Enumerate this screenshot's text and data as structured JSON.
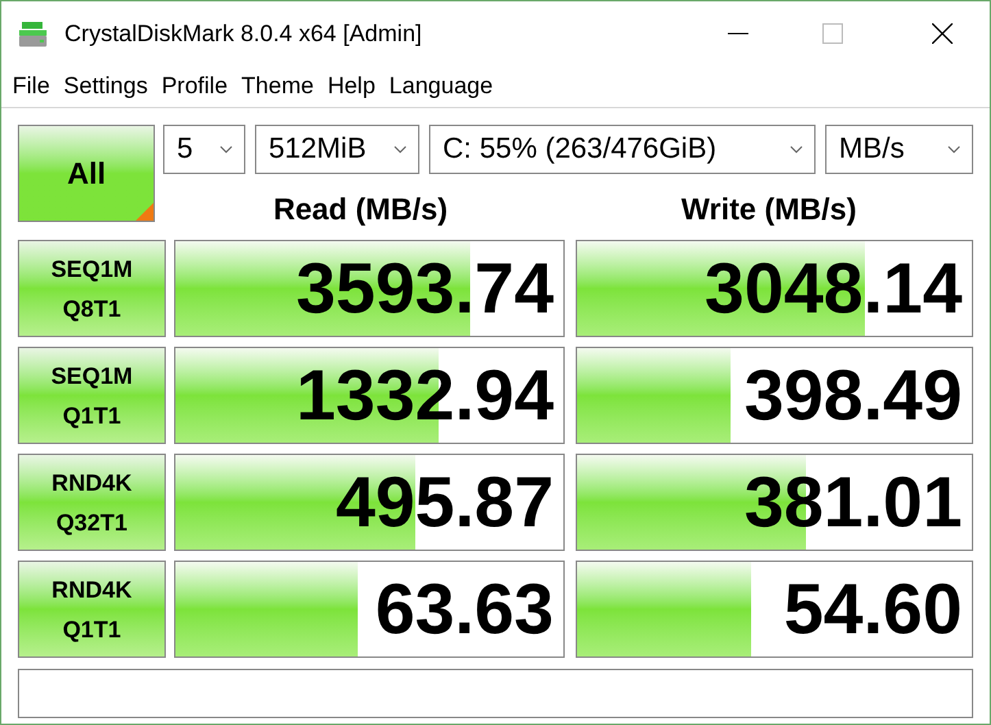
{
  "window": {
    "title": "CrystalDiskMark 8.0.4 x64 [Admin]"
  },
  "menu": [
    "File",
    "Settings",
    "Profile",
    "Theme",
    "Help",
    "Language"
  ],
  "all_button": {
    "label": "All"
  },
  "selectors": [
    {
      "value": "5"
    },
    {
      "value": "512MiB"
    },
    {
      "value": "C: 55% (263/476GiB)"
    },
    {
      "value": "MB/s"
    }
  ],
  "columns": [
    "Read (MB/s)",
    "Write (MB/s)"
  ],
  "tests": [
    {
      "label": [
        "SEQ1M",
        "Q8T1"
      ],
      "read": {
        "value": "3593.74",
        "level": 0.76
      },
      "write": {
        "value": "3048.14",
        "level": 0.73
      }
    },
    {
      "label": [
        "SEQ1M",
        "Q1T1"
      ],
      "read": {
        "value": "1332.94",
        "level": 0.68
      },
      "write": {
        "value": "398.49",
        "level": 0.39
      }
    },
    {
      "label": [
        "RND4K",
        "Q32T1"
      ],
      "read": {
        "value": "495.87",
        "level": 0.62
      },
      "write": {
        "value": "381.01",
        "level": 0.58
      }
    },
    {
      "label": [
        "RND4K",
        "Q1T1"
      ],
      "read": {
        "value": "63.63",
        "level": 0.47
      },
      "write": {
        "value": "54.60",
        "level": 0.44
      }
    }
  ]
}
